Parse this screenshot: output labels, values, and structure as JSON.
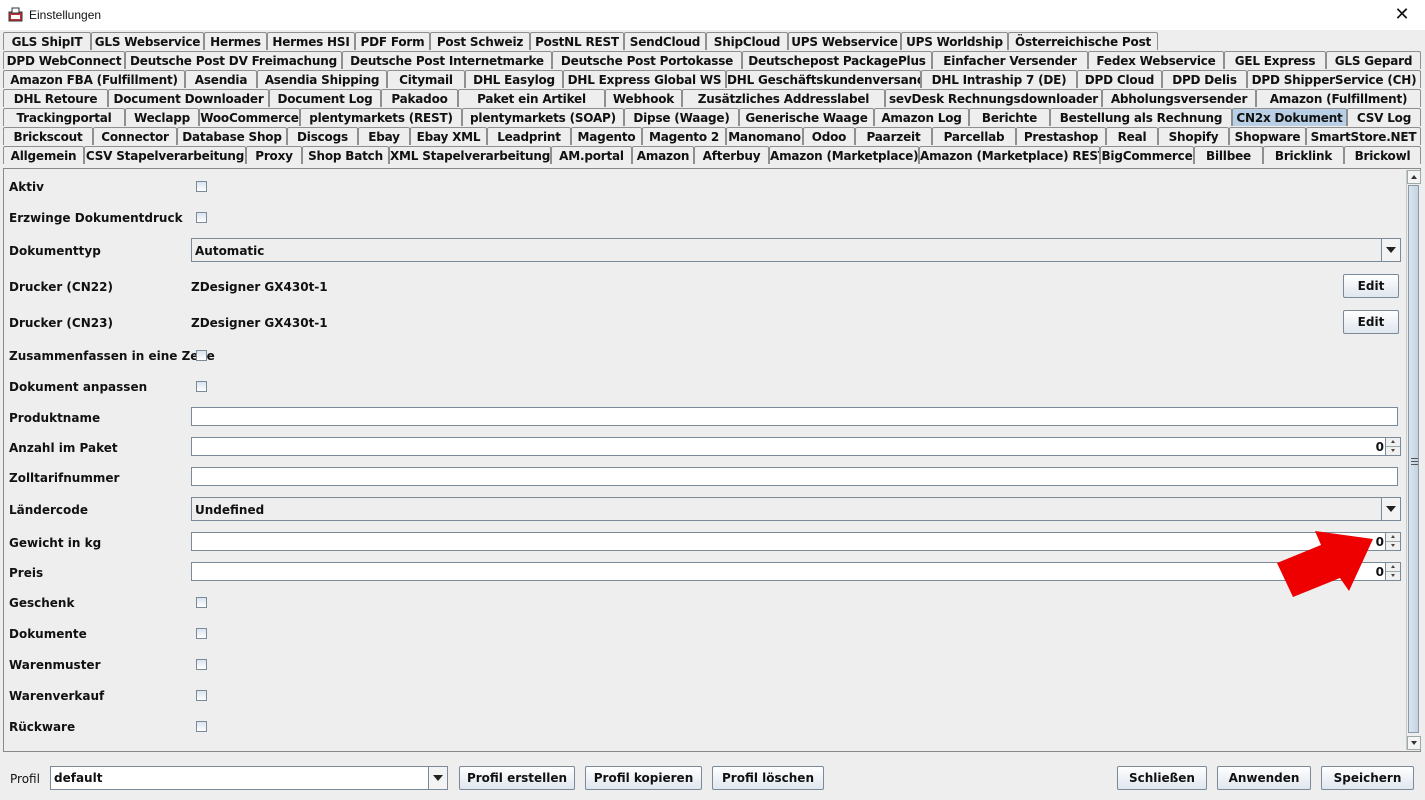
{
  "window": {
    "title": "Einstellungen",
    "close_glyph": "✕"
  },
  "tabs": {
    "rows": [
      [
        "GLS ShipIT",
        "GLS Webservice",
        "Hermes",
        "Hermes HSI",
        "PDF Form",
        "Post Schweiz",
        "PostNL REST",
        "SendCloud",
        "ShipCloud",
        "UPS Webservice",
        "UPS Worldship",
        "Österreichische Post"
      ],
      [
        "DPD WebConnect",
        "Deutsche Post DV Freimachung",
        "Deutsche Post Internetmarke",
        "Deutsche Post Portokasse",
        "Deutschepost PackagePlus",
        "Einfacher Versender",
        "Fedex Webservice",
        "GEL Express",
        "GLS Gepard"
      ],
      [
        "Amazon FBA (Fulfillment)",
        "Asendia",
        "Asendia Shipping",
        "Citymail",
        "DHL Easylog",
        "DHL Express Global WS",
        "DHL Geschäftskundenversand",
        "DHL Intraship 7 (DE)",
        "DPD Cloud",
        "DPD Delis",
        "DPD ShipperService (CH)"
      ],
      [
        "DHL Retoure",
        "Document Downloader",
        "Document Log",
        "Pakadoo",
        "Paket ein Artikel",
        "Webhook",
        "Zusätzliches Addresslabel",
        "sevDesk Rechnungsdownloader",
        "Abholungsversender",
        "Amazon (Fulfillment)"
      ],
      [
        "Trackingportal",
        "Weclapp",
        "WooCommerce",
        "plentymarkets (REST)",
        "plentymarkets (SOAP)",
        "Dipse (Waage)",
        "Generische Waage",
        "Amazon Log",
        "Berichte",
        "Bestellung als Rechnung",
        "CN2x Dokument",
        "CSV Log"
      ],
      [
        "Brickscout",
        "Connector",
        "Database Shop",
        "Discogs",
        "Ebay",
        "Ebay XML",
        "Leadprint",
        "Magento",
        "Magento 2",
        "Manomano",
        "Odoo",
        "Paarzeit",
        "Parcellab",
        "Prestashop",
        "Real",
        "Shopify",
        "Shopware",
        "SmartStore.NET"
      ],
      [
        "Allgemein",
        "CSV Stapelverarbeitung",
        "Proxy",
        "Shop Batch",
        "XML Stapelverarbeitung",
        "AM.portal",
        "Amazon",
        "Afterbuy",
        "Amazon (Marketplace)",
        "Amazon (Marketplace) REST",
        "BigCommerce",
        "Billbee",
        "Bricklink",
        "Brickowl"
      ]
    ],
    "active": "CN2x Dokument"
  },
  "form": {
    "aktiv": "Aktiv",
    "erzwinge": "Erzwinge Dokumentdruck",
    "dokumenttyp_label": "Dokumenttyp",
    "dokumenttyp_value": "Automatic",
    "drucker_cn22_label": "Drucker (CN22)",
    "drucker_cn22_value": "ZDesigner GX430t-1",
    "drucker_cn23_label": "Drucker (CN23)",
    "drucker_cn23_value": "ZDesigner GX430t-1",
    "edit_label": "Edit",
    "zusammenfassen": "Zusammenfassen in eine Zeile",
    "anpassen": "Dokument anpassen",
    "produktname_label": "Produktname",
    "produktname_value": "",
    "anzahl_label": "Anzahl im Paket",
    "anzahl_value": "0",
    "zolltarif_label": "Zolltarifnummer",
    "zolltarif_value": "",
    "laendercode_label": "Ländercode",
    "laendercode_value": "Undefined",
    "gewicht_label": "Gewicht in kg",
    "gewicht_value": "0",
    "preis_label": "Preis",
    "preis_value": "0",
    "geschenk": "Geschenk",
    "dokumente": "Dokumente",
    "warenmuster": "Warenmuster",
    "warenverkauf": "Warenverkauf",
    "rueckware": "Rückware"
  },
  "bottom": {
    "profil_label": "Profil",
    "profil_value": "default",
    "erstellen": "Profil erstellen",
    "kopieren": "Profil kopieren",
    "loeschen": "Profil löschen",
    "schliessen": "Schließen",
    "anwenden": "Anwenden",
    "speichern": "Speichern"
  },
  "colors": {
    "active_tab": "#b8cfe5",
    "annotation_arrow": "#ee0000"
  }
}
